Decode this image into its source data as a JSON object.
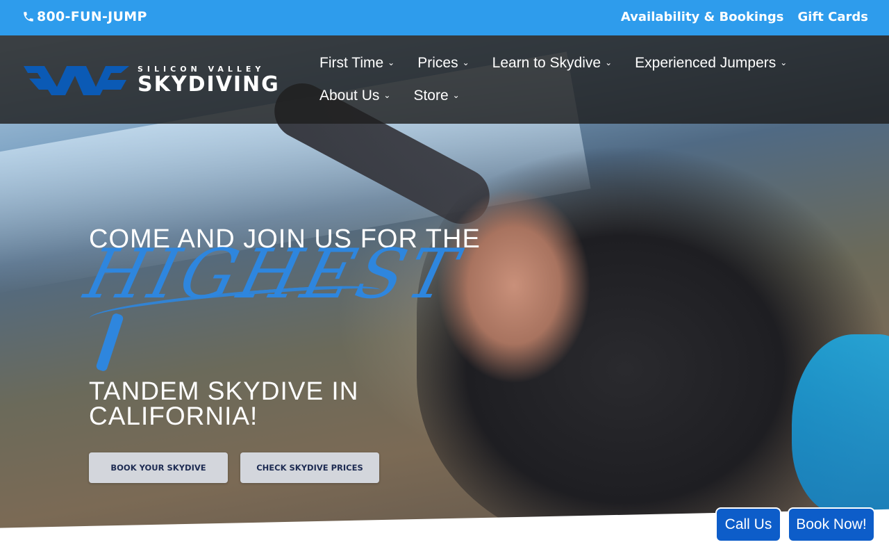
{
  "topbar": {
    "phone": "800-FUN-JUMP",
    "links": [
      "Availability & Bookings",
      "Gift Cards"
    ]
  },
  "logo": {
    "small": "SILICON VALLEY",
    "big": "SKYDIVING"
  },
  "nav": {
    "items": [
      "First Time",
      "Prices",
      "Learn to Skydive",
      "Experienced Jumpers",
      "About Us",
      "Store"
    ]
  },
  "hero": {
    "line1": "COME AND JOIN US FOR THE",
    "script": "HIGHEST",
    "line2": "TANDEM SKYDIVE IN CALIFORNIA!",
    "buttons": [
      "BOOK YOUR SKYDIVE",
      "CHECK SKYDIVE PRICES"
    ]
  },
  "cta": {
    "call": "Call Us",
    "book": "Book Now!"
  },
  "colors": {
    "topbar": "#2e9cec",
    "accent": "#2e86de",
    "cta": "#0d5dc9"
  },
  "icons": [
    "phone-icon",
    "chevron-down-icon",
    "svs-logo-icon"
  ]
}
